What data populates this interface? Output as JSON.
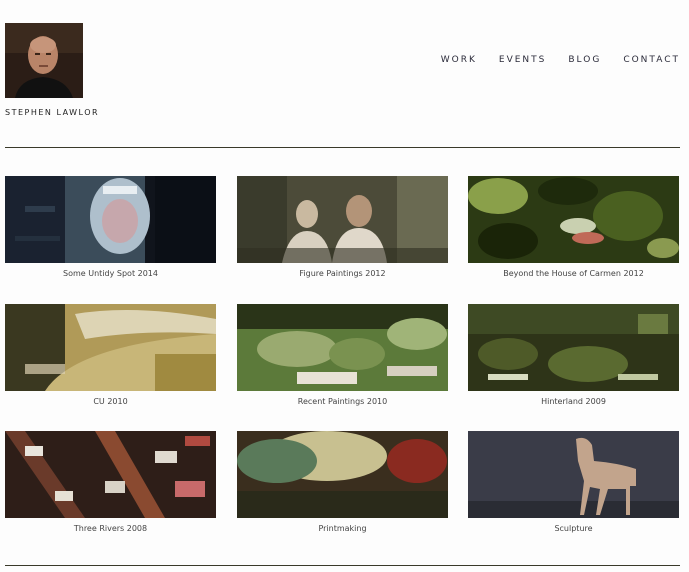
{
  "header": {
    "site_name": "STEPHEN LAWLOR"
  },
  "nav": {
    "items": [
      {
        "label": "WORK"
      },
      {
        "label": "EVENTS"
      },
      {
        "label": "BLOG"
      },
      {
        "label": "CONTACT"
      }
    ]
  },
  "gallery": {
    "items": [
      {
        "caption": "Some Untidy Spot 2014"
      },
      {
        "caption": "Figure Paintings 2012"
      },
      {
        "caption": "Beyond the House of Carmen 2012"
      },
      {
        "caption": "CU 2010"
      },
      {
        "caption": "Recent Paintings 2010"
      },
      {
        "caption": "Hinterland 2009"
      },
      {
        "caption": "Three Rivers 2008"
      },
      {
        "caption": "Printmaking"
      },
      {
        "caption": "Sculpture"
      }
    ]
  }
}
